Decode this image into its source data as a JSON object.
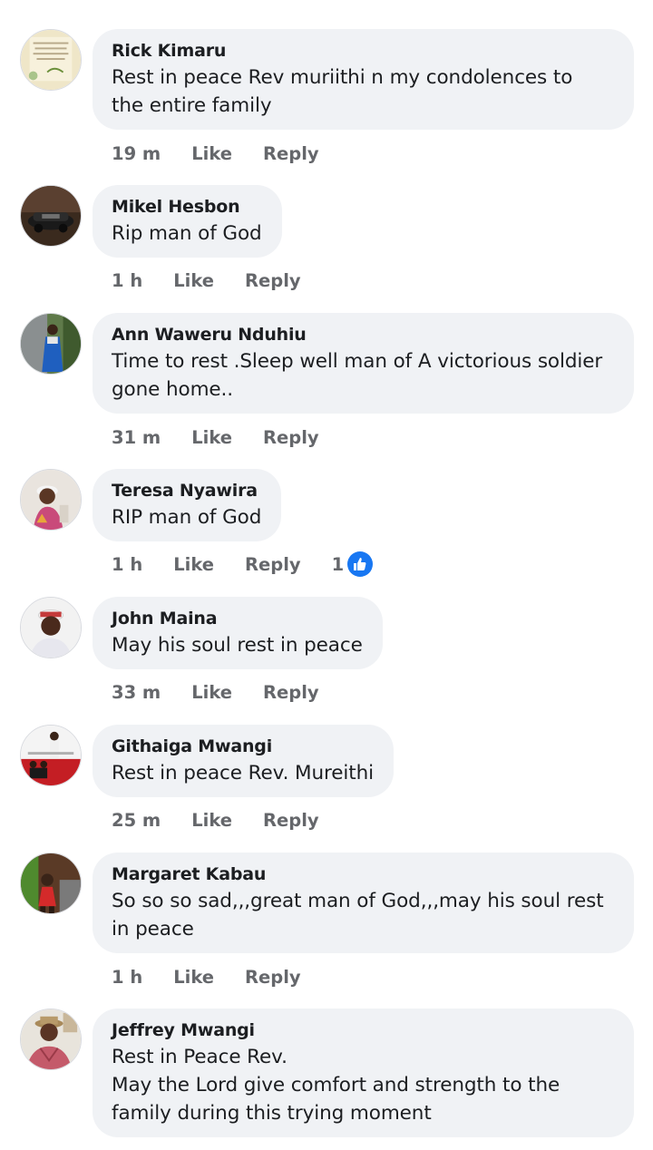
{
  "colors": {
    "bubble": "#f0f2f5",
    "name": "#1c1e21",
    "meta": "#65676b",
    "like_blue": "#1877f2"
  },
  "comments": [
    {
      "name": "Rick Kimaru",
      "lines": [
        "Rest in peace Rev muriithi n my condolences to",
        "the entire family"
      ],
      "time": "19 m",
      "like": "Like",
      "reply": "Reply"
    },
    {
      "name": "Mikel Hesbon",
      "lines": [
        "Rip man of God"
      ],
      "time": "1 h",
      "like": "Like",
      "reply": "Reply"
    },
    {
      "name": "Ann Waweru Nduhiu",
      "lines": [
        "Time to rest .Sleep well man of A victorious soldier",
        "gone home.."
      ],
      "time": "31 m",
      "like": "Like",
      "reply": "Reply"
    },
    {
      "name": "Teresa Nyawira",
      "lines": [
        "RIP man of God"
      ],
      "time": "1 h",
      "like": "Like",
      "reply": "Reply",
      "reaction_count": "1",
      "reaction_icon": "thumbs-up-icon"
    },
    {
      "name": "John Maina",
      "lines": [
        "May his soul rest in peace"
      ],
      "time": "33 m",
      "like": "Like",
      "reply": "Reply"
    },
    {
      "name": "Githaiga Mwangi",
      "lines": [
        "Rest in peace Rev. Mureithi"
      ],
      "time": "25 m",
      "like": "Like",
      "reply": "Reply"
    },
    {
      "name": "Margaret Kabau",
      "lines": [
        "So so so sad,,,great man of God,,,may his soul rest",
        "in peace"
      ],
      "time": "1 h",
      "like": "Like",
      "reply": "Reply"
    },
    {
      "name": "Jeffrey Mwangi",
      "lines": [
        "Rest in Peace Rev.",
        "May the Lord give comfort and strength to the",
        "family during this trying moment"
      ]
    }
  ]
}
